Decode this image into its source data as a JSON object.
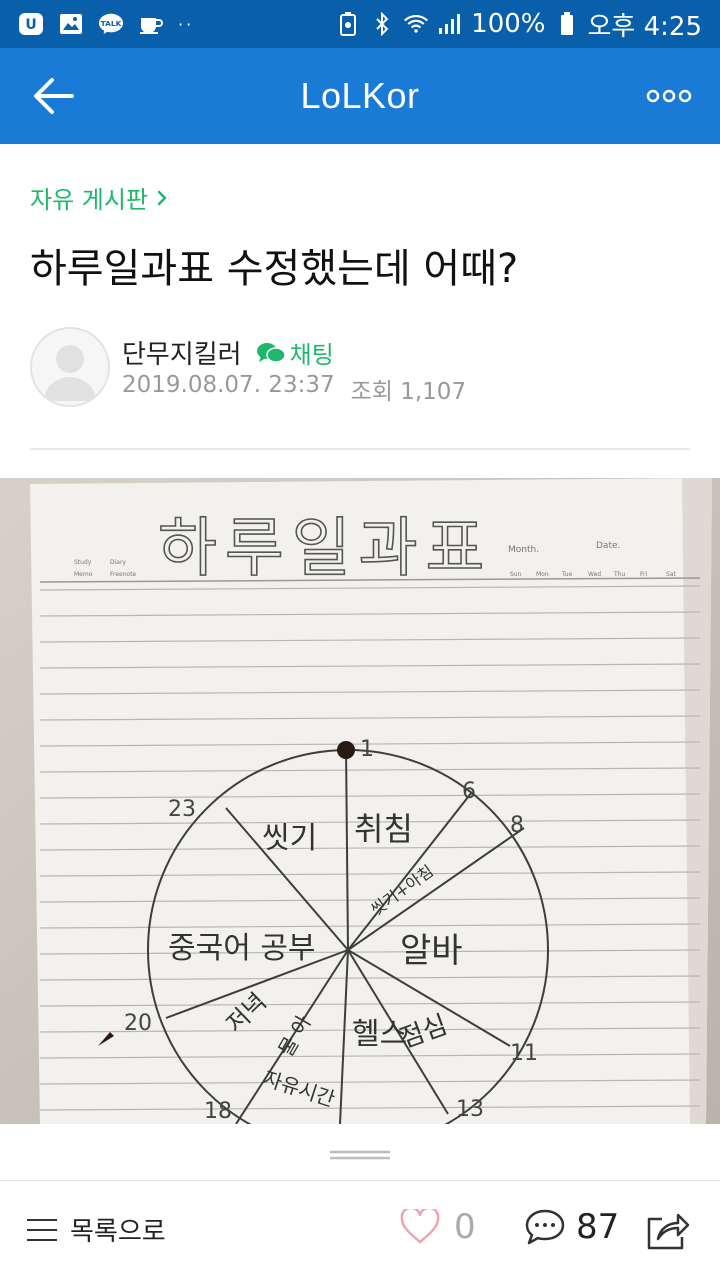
{
  "status_bar": {
    "battery": "100%",
    "time": "오후 4:25",
    "dots": "··"
  },
  "app_bar": {
    "title": "LoLKor"
  },
  "post": {
    "board": "자유 게시판",
    "title": "하루일과표 수정했는데 어때?",
    "author": "단무지킬러",
    "chat_label": "채팅",
    "date": "2019.08.07. 23:37",
    "views_label": "조회",
    "views": "1,107"
  },
  "image": {
    "sheet_title": "하루일과표",
    "month_label": "Month.",
    "date_label": "Date.",
    "checkbox_left": [
      "Study",
      "Diary",
      "Memo",
      "Freenote"
    ],
    "weekdays": [
      "Sun",
      "Mon",
      "Tue",
      "Wed",
      "Thu",
      "Fri",
      "Sat"
    ],
    "hours": [
      "1",
      "6",
      "8",
      "11",
      "13",
      "18",
      "20",
      "23"
    ],
    "segments": [
      "씻기",
      "취침",
      "씻기+아침",
      "알바",
      "점심",
      "헬스",
      "저녁",
      "물 아",
      "자유시간",
      "중국어 공부"
    ]
  },
  "bottom_bar": {
    "list_label": "목록으로",
    "likes": "0",
    "comments": "87"
  }
}
